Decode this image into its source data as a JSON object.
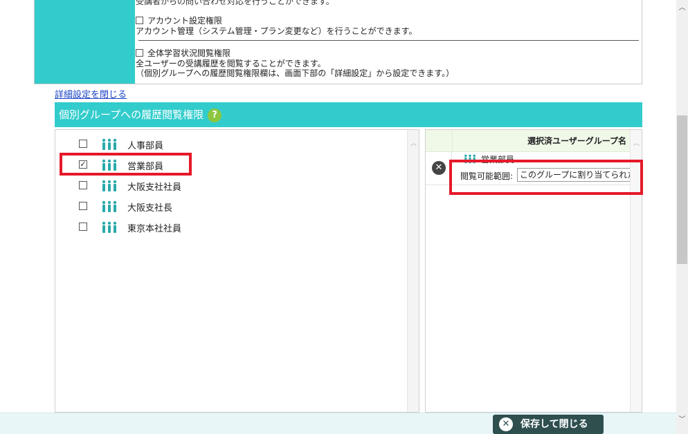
{
  "permissions": {
    "cut_line": "受講者からの問い合わせ対応を行うことができます。",
    "account_title": "アカウント設定権限",
    "account_desc": "アカウント管理（システム管理・プラン変更など）を行うことができます。",
    "progress_title": "全体学習状況閲覧権限",
    "progress_desc_1": "全ユーザーの受講履歴を閲覧することができます。",
    "progress_desc_2": "（個別グループへの履歴閲覧権限欄は、画面下部の「詳細設定」から設定できます。）"
  },
  "close_details_link": "詳細設定を閉じる",
  "section": {
    "title": "個別グループへの履歴閲覧権限",
    "help": "?"
  },
  "groups": [
    {
      "name": "人事部員",
      "checked": false
    },
    {
      "name": "営業部員",
      "checked": true
    },
    {
      "name": "大阪支社社員",
      "checked": false
    },
    {
      "name": "大阪支社長",
      "checked": false
    },
    {
      "name": "東京本社社員",
      "checked": false
    }
  ],
  "selected": {
    "header": "選択済ユーザーグループ名",
    "rows": [
      {
        "name": "営業部員",
        "range_label": "閲覧可能範囲:",
        "range_value": "このグループに割り当てられたコ"
      }
    ]
  },
  "footer": {
    "save_close": "保存して閉じる"
  },
  "colors": {
    "teal": "#33cccc",
    "highlight": "#e5192a",
    "button": "#2f4f4f",
    "help": "#8cc63f"
  }
}
